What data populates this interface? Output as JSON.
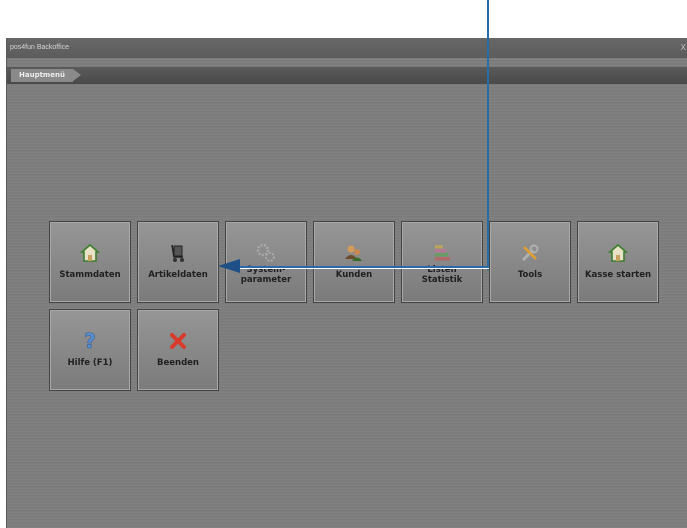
{
  "window": {
    "title": "pos4fun Backoffice",
    "close_label": "X"
  },
  "breadcrumb": {
    "label": "Hauptmenü"
  },
  "tiles_row1": [
    {
      "label": "Stammdaten",
      "icon": "house-icon"
    },
    {
      "label": "Artikeldaten",
      "icon": "trolley-icon"
    },
    {
      "label": "System-\nparameter",
      "icon": "gears-icon",
      "disabled": true
    },
    {
      "label": "Kunden",
      "icon": "customers-icon"
    },
    {
      "label": "Listen\nStatistik",
      "icon": "stacked-bars-icon",
      "disabled": true
    },
    {
      "label": "Tools",
      "icon": "tools-icon"
    },
    {
      "label": "Kasse starten",
      "icon": "house-icon"
    }
  ],
  "tiles_row2": [
    {
      "label": "Hilfe (F1)",
      "icon": "question-icon"
    },
    {
      "label": "Beenden",
      "icon": "close-x-icon"
    }
  ],
  "colors": {
    "annotation": "#2a6aa8",
    "exit_red": "#d83a2c"
  }
}
